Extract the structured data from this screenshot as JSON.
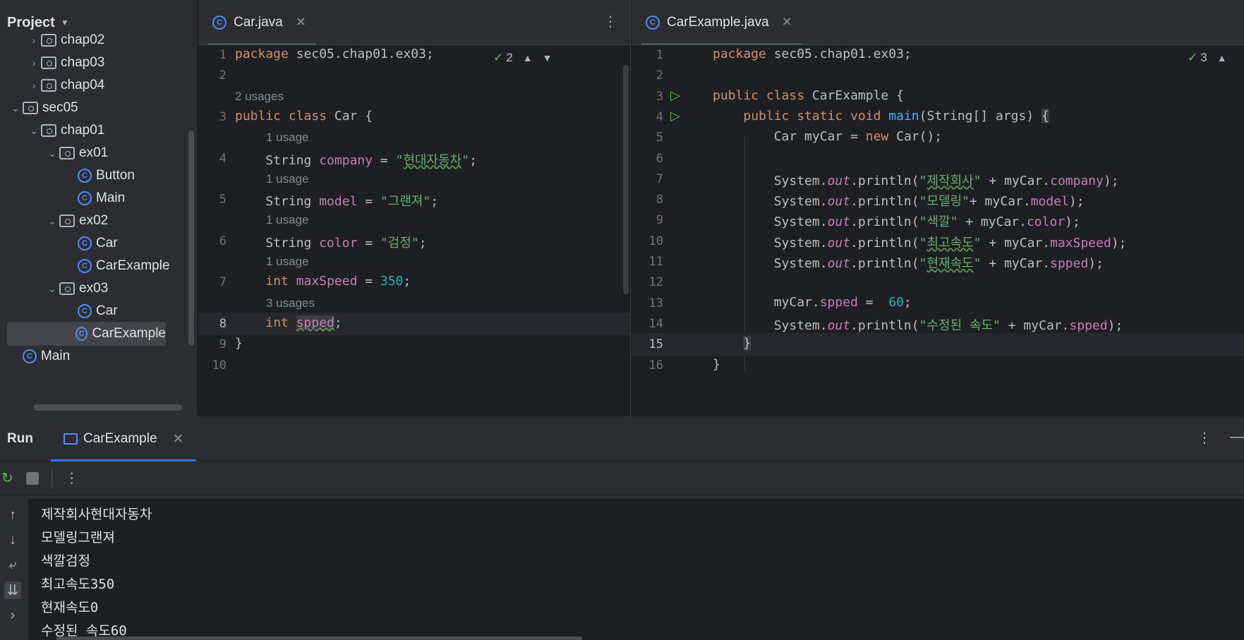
{
  "project": {
    "title": "Project",
    "tree": [
      {
        "label": "chap02",
        "type": "folder",
        "arrow": "›",
        "indent": 1
      },
      {
        "label": "chap03",
        "type": "folder",
        "arrow": "›",
        "indent": 1
      },
      {
        "label": "chap04",
        "type": "folder",
        "arrow": "›",
        "indent": 1
      },
      {
        "label": "sec05",
        "type": "folder",
        "arrow": "⌄",
        "indent": 0
      },
      {
        "label": "chap01",
        "type": "folder",
        "arrow": "⌄",
        "indent": 1
      },
      {
        "label": "ex01",
        "type": "folder",
        "arrow": "⌄",
        "indent": 2
      },
      {
        "label": "Button",
        "type": "class",
        "arrow": "",
        "indent": 3
      },
      {
        "label": "Main",
        "type": "class",
        "arrow": "",
        "indent": 3
      },
      {
        "label": "ex02",
        "type": "folder",
        "arrow": "⌄",
        "indent": 2
      },
      {
        "label": "Car",
        "type": "class",
        "arrow": "",
        "indent": 3
      },
      {
        "label": "CarExample",
        "type": "class",
        "arrow": "",
        "indent": 3
      },
      {
        "label": "ex03",
        "type": "folder",
        "arrow": "⌄",
        "indent": 2
      },
      {
        "label": "Car",
        "type": "class",
        "arrow": "",
        "indent": 3
      },
      {
        "label": "CarExample",
        "type": "class",
        "arrow": "",
        "indent": 3,
        "selected": true
      },
      {
        "label": "Main",
        "type": "class",
        "arrow": "",
        "indent": 0
      }
    ]
  },
  "editor_left": {
    "tab_label": "Car.java",
    "inspection_count": "2",
    "lines": [
      {
        "n": "1",
        "hint": "",
        "html": "<span class='kw'>package</span> sec05.chap01.ex03;"
      },
      {
        "n": "2",
        "hint": "",
        "html": ""
      },
      {
        "n": "3",
        "hint": "2 usages",
        "html": "<span class='kw'>public class</span> Car {"
      },
      {
        "n": "4",
        "hint": "1 usage",
        "html": "    String <span class='fld'>company</span> = <span class='str'>\"<span class='squig'>현대자동차</span>\"</span>;"
      },
      {
        "n": "5",
        "hint": "1 usage",
        "html": "    String <span class='fld'>model</span> = <span class='str'>\"그랜져\"</span>;"
      },
      {
        "n": "6",
        "hint": "1 usage",
        "html": "    String <span class='fld'>color</span> = <span class='str'>\"검정\"</span>;"
      },
      {
        "n": "7",
        "hint": "1 usage",
        "html": "    <span class='kw'>int</span> <span class='fld'>maxSpeed</span> = <span class='num'>350</span>;"
      },
      {
        "n": "8",
        "hint": "3 usages",
        "html": "    <span class='kw'>int</span> <span class='fld squig hl'>spped</span>;",
        "current": true
      },
      {
        "n": "9",
        "hint": "",
        "html": "}"
      },
      {
        "n": "10",
        "hint": "",
        "html": ""
      }
    ]
  },
  "editor_right": {
    "tab_label": "CarExample.java",
    "inspection_count": "3",
    "lines": [
      {
        "n": "1",
        "html": "<span class='kw'>package</span> sec05.chap01.ex03;"
      },
      {
        "n": "2",
        "html": ""
      },
      {
        "n": "3",
        "html": "<span class='kw'>public class</span> CarExample {",
        "run": true
      },
      {
        "n": "4",
        "html": "    <span class='kw'>public static void</span> <span class='fn'>main</span>(String[] args) <span class='hl'>{</span>",
        "run": true
      },
      {
        "n": "5",
        "html": "        Car myCar = <span class='kw'>new</span> Car();"
      },
      {
        "n": "6",
        "html": ""
      },
      {
        "n": "7",
        "html": "        System.<span class='fld it'>out</span>.println(<span class='str'>\"<span class='squig'>제작회사</span>\"</span> + myCar.<span class='fld'>company</span>);"
      },
      {
        "n": "8",
        "html": "        System.<span class='fld it'>out</span>.println(<span class='str'>\"모델링\"</span>+ myCar.<span class='fld'>model</span>);"
      },
      {
        "n": "9",
        "html": "        System.<span class='fld it'>out</span>.println(<span class='str'>\"색깔\"</span> + myCar.<span class='fld'>color</span>);"
      },
      {
        "n": "10",
        "html": "        System.<span class='fld it'>out</span>.println(<span class='str'>\"<span class='squig'>최고속도</span>\"</span> + myCar.<span class='fld'>maxSpeed</span>);"
      },
      {
        "n": "11",
        "html": "        System.<span class='fld it'>out</span>.println(<span class='str'>\"<span class='squig'>현재속도</span>\"</span> + myCar.<span class='fld'>spped</span>);"
      },
      {
        "n": "12",
        "html": ""
      },
      {
        "n": "13",
        "html": "        myCar.<span class='fld'>spped</span> =  <span class='num'>60</span>;"
      },
      {
        "n": "14",
        "html": "        System.<span class='fld it'>out</span>.println(<span class='str'>\"수정된 속도\"</span> + myCar.<span class='fld'>spped</span>);"
      },
      {
        "n": "15",
        "html": "    <span class='hl'>}</span>",
        "current": true
      },
      {
        "n": "16",
        "html": "}"
      }
    ]
  },
  "run": {
    "title": "Run",
    "tab_label": "CarExample",
    "output": [
      "제작회사현대자동차",
      "모델링그랜져",
      "색깔검정",
      "최고속도350",
      "현재속도0",
      "수정된 속도60"
    ]
  },
  "icons": {
    "more": "⋮",
    "close": "✕",
    "rerun": "↻",
    "up": "↑",
    "down": "↓",
    "minimize": "—"
  },
  "colors": {
    "keyword": "#cf8e6d",
    "string": "#6aab73",
    "field": "#c77dbb",
    "number": "#2aacb8",
    "accent": "#3574f0"
  }
}
